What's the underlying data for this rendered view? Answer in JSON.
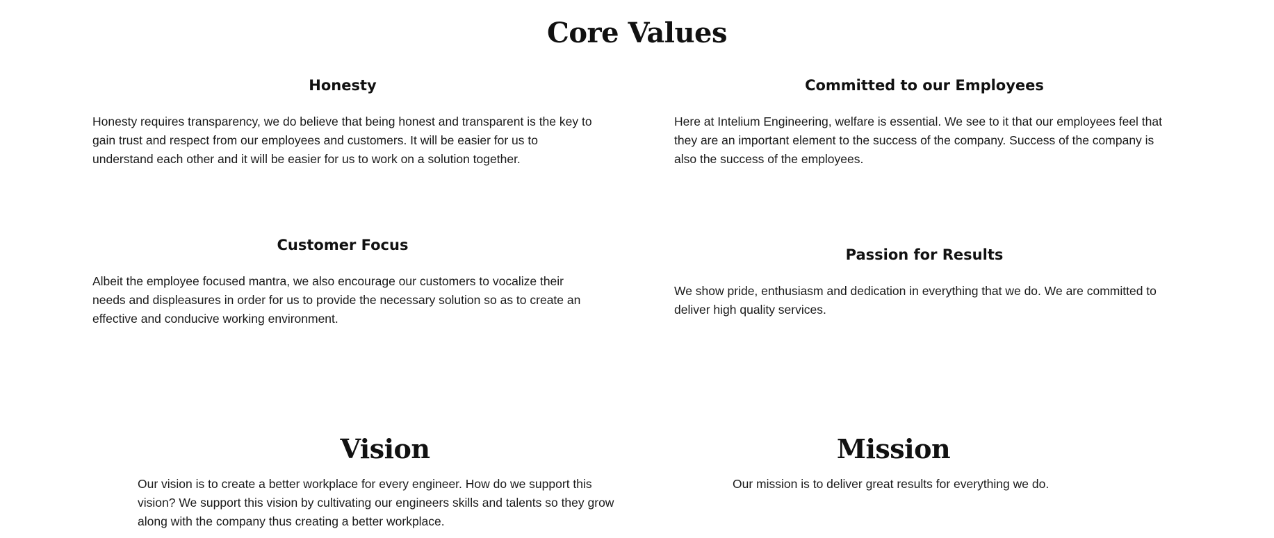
{
  "core_values": {
    "title": "Core Values",
    "items": [
      {
        "heading": "Honesty",
        "text": "Honesty requires transparency, we do believe that being honest and transparent is the key to gain trust and respect from our employees and customers. It will be easier for us to understand each other and it will be easier for us to work on a solution together."
      },
      {
        "heading": "Committed to our Employees",
        "text": "Here at Intelium Engineering, welfare is essential. We see to it that our employees feel that they are an important element to the success of the company. Success of the company is also the success of the employees."
      },
      {
        "heading": "Customer Focus",
        "text": "Albeit the employee focused mantra, we also encourage our customers to vocalize their needs and displeasures in order for us to provide the necessary solution so as to create an effective and conducive working environment."
      },
      {
        "heading": "Passion for Results",
        "text": "We show pride, enthusiasm and dedication in everything that we do. We are committed to deliver high quality services."
      }
    ]
  },
  "vision": {
    "heading": "Vision",
    "text": "Our vision is to create a better workplace for every engineer. How do we support this vision? We support this vision by cultivating our engineers skills and talents so they grow along with the company thus creating a better workplace."
  },
  "mission": {
    "heading": "Mission",
    "text": "Our mission is to deliver great results for everything we do."
  }
}
